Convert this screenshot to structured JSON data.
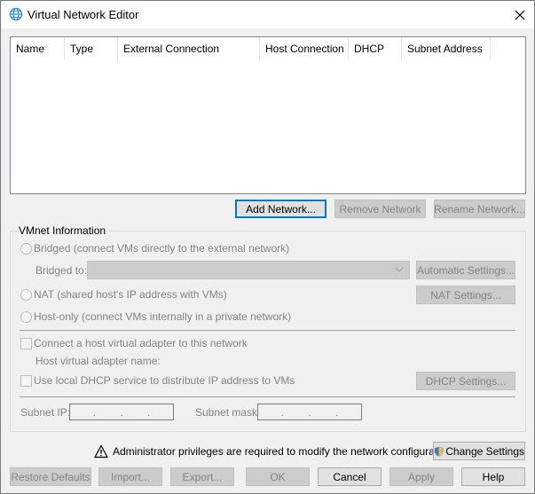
{
  "window": {
    "title": "Virtual Network Editor",
    "close_icon": "close-icon",
    "app_icon": "globe-icon"
  },
  "list": {
    "columns": [
      "Name",
      "Type",
      "External Connection",
      "Host Connection",
      "DHCP",
      "Subnet Address"
    ],
    "rows": []
  },
  "list_buttons": {
    "add": "Add Network...",
    "remove": "Remove Network",
    "rename": "Rename Network..."
  },
  "vmnet": {
    "group_label": "VMnet Information",
    "bridged_label": "Bridged (connect VMs directly to the external network)",
    "bridged_to_label": "Bridged to:",
    "bridged_to_value": "",
    "automatic_settings": "Automatic Settings...",
    "nat_label": "NAT (shared host's IP address with VMs)",
    "nat_settings": "NAT Settings...",
    "hostonly_label": "Host-only (connect VMs internally in a private network)",
    "connect_adapter_label": "Connect a host virtual adapter to this network",
    "adapter_name_label": "Host virtual adapter name:",
    "dhcp_label": "Use local DHCP service to distribute IP address to VMs",
    "dhcp_settings": "DHCP Settings...",
    "subnet_ip_label": "Subnet IP:",
    "subnet_mask_label": "Subnet mask:",
    "ip_dots": ".",
    "selected_mode": "none"
  },
  "admin": {
    "message": "Administrator privileges are required to modify the network configuration.",
    "change_settings": "Change Settings"
  },
  "footer": {
    "restore": "Restore Defaults",
    "import": "Import...",
    "export": "Export...",
    "ok": "OK",
    "cancel": "Cancel",
    "apply": "Apply",
    "help": "Help"
  },
  "colors": {
    "focus_border": "#0078d7",
    "disabled_text": "#838383",
    "warning_yellow": "#f7c948"
  }
}
